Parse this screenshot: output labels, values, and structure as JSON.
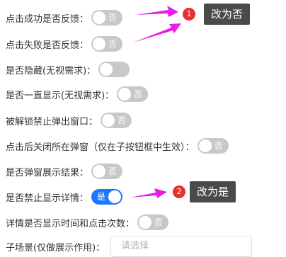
{
  "colors": {
    "switch_on": "#1e78ff",
    "switch_off": "#c8c8c8",
    "annotation_arrow": "#e81ce6",
    "badge": "#e9302e",
    "callout_bg": "#4a4a4a"
  },
  "settings": [
    {
      "label": "点击成功是否反馈：",
      "state": "off",
      "text": "否"
    },
    {
      "label": "点击失败是否反馈：",
      "state": "off",
      "text": "否"
    },
    {
      "label": "是否隐藏(无视需求)：",
      "state": "off",
      "text": ""
    },
    {
      "label": "是否一直显示(无视需求)：",
      "state": "off",
      "text": "否"
    },
    {
      "label": "被解锁禁止弹出窗口：",
      "state": "off",
      "text": "否"
    },
    {
      "label": "点击后关闭所在弹窗（仅在子按钮框中生效）：",
      "state": "off",
      "text": "否"
    },
    {
      "label": "是否弹窗展示结果：",
      "state": "off",
      "text": "否"
    },
    {
      "label": "是否禁止显示详情：",
      "state": "on",
      "text": "是"
    },
    {
      "label": "详情是否显示时间和点击次数：",
      "state": "off",
      "text": "否"
    }
  ],
  "scene": {
    "label": "子场景(仅做展示作用)：",
    "placeholder": "请选择"
  },
  "annotations": [
    {
      "badge": "1",
      "text": "改为否"
    },
    {
      "badge": "2",
      "text": "改为是"
    }
  ]
}
